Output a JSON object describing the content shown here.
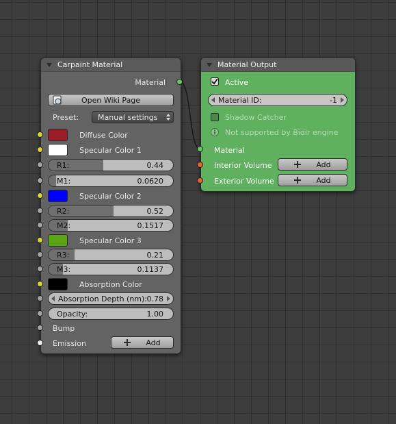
{
  "carpaint": {
    "title": "Carpaint Material",
    "output_label": "Material",
    "wiki_button": "Open Wiki Page",
    "preset_label": "Preset:",
    "preset_value": "Manual settings",
    "diffuse_label": "Diffuse Color",
    "diffuse_color": "#9a1d28",
    "specular1_label": "Specular Color 1",
    "specular1_color": "#ffffff",
    "r1": {
      "label": "R1:",
      "value": "0.44",
      "fraction": 0.44
    },
    "m1": {
      "label": "M1:",
      "value": "0.0620",
      "fraction": 0.062
    },
    "specular2_label": "Specular Color 2",
    "specular2_color": "#0000ff",
    "r2": {
      "label": "R2:",
      "value": "0.52",
      "fraction": 0.52
    },
    "m2": {
      "label": "M2:",
      "value": "0.1517",
      "fraction": 0.1517
    },
    "specular3_label": "Specular Color 3",
    "specular3_color": "#5aa514",
    "r3": {
      "label": "R3:",
      "value": "0.21",
      "fraction": 0.21
    },
    "m3": {
      "label": "M3:",
      "value": "0.1137",
      "fraction": 0.1137
    },
    "absorption_label": "Absorption Color",
    "absorption_color": "#000000",
    "absorption_depth": {
      "label": "Absorption Depth (nm):",
      "value": "0.78"
    },
    "opacity": {
      "label": "Opacity:",
      "value": "1.00"
    },
    "bump_label": "Bump",
    "emission_label": "Emission",
    "emission_add": "Add"
  },
  "matout": {
    "title": "Material Output",
    "active_label": "Active",
    "material_id": {
      "label": "Material ID:",
      "value": "-1"
    },
    "shadow_catcher_label": "Shadow Catcher",
    "not_supported_text": "Not supported by Bidir engine",
    "material_input_label": "Material",
    "interior_label": "Interior Volume",
    "interior_add": "Add",
    "exterior_label": "Exterior Volume",
    "exterior_add": "Add"
  },
  "icons": [
    "collapse-triangle-icon",
    "wiki-icon",
    "updown-arrows-icon",
    "plus-icon",
    "checkmark-icon",
    "info-icon",
    "arrow-left-icon",
    "arrow-right-icon"
  ]
}
